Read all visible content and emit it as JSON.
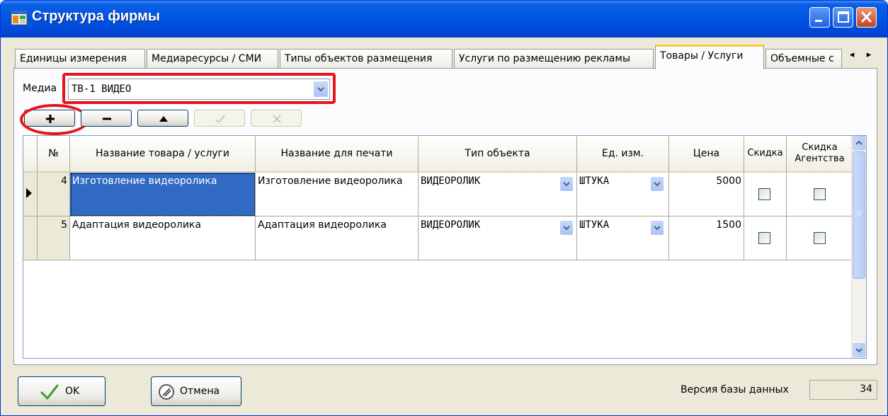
{
  "window": {
    "title": "Структура фирмы"
  },
  "tabs": [
    {
      "label": "Единицы измерения"
    },
    {
      "label": "Медиаресурсы / СМИ"
    },
    {
      "label": "Типы объектов размещения"
    },
    {
      "label": "Услуги по размещению рекламы"
    },
    {
      "label": "Товары / Услуги",
      "active": true
    },
    {
      "label": "Объемные с"
    }
  ],
  "media": {
    "label": "Медиа",
    "value": "ТВ-1 ВИДЕО"
  },
  "grid": {
    "headers": {
      "num": "№",
      "name": "Название товара / услуги",
      "print_name": "Название для печати",
      "object_type": "Тип объекта",
      "unit": "Ед. изм.",
      "price": "Цена",
      "discount": "Скидка",
      "agency_discount": "Скидка Агентства"
    },
    "rows": [
      {
        "num": "4",
        "name": "Изготовление видеоролика",
        "print_name": "Изготовление видеоролика",
        "object_type": "ВИДЕОРОЛИК",
        "unit": "ШТУКА",
        "price": "5000",
        "discount": false,
        "agency_discount": false,
        "current": true
      },
      {
        "num": "5",
        "name": "Адаптация видеоролика",
        "print_name": "Адаптация видеоролика",
        "object_type": "ВИДЕОРОЛИК",
        "unit": "ШТУКА",
        "price": "1500",
        "discount": false,
        "agency_discount": false,
        "current": false
      }
    ]
  },
  "footer": {
    "ok_label": "OK",
    "cancel_label": "Отмена",
    "db_version_label": "Версия базы данных",
    "db_version_value": "34"
  },
  "icons": {
    "add": "plus-icon",
    "remove": "minus-icon",
    "move_up": "triangle-up-icon",
    "confirm": "check-icon",
    "discard": "x-icon",
    "ok": "green-check-icon",
    "cancel": "cancel-circle-icon"
  },
  "colors": {
    "selection": "#316AC5",
    "annotation": "#E8141B",
    "titlebar": "#0054E3"
  }
}
